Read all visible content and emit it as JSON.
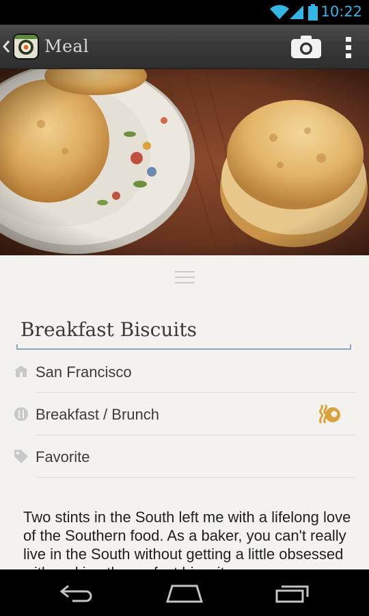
{
  "status_bar": {
    "time": "10:22",
    "icons": [
      "wifi-icon",
      "signal-icon",
      "battery-icon"
    ],
    "accent": "#33b5e5"
  },
  "action_bar": {
    "title": "Meal",
    "actions": [
      "camera-icon",
      "overflow-menu-icon"
    ]
  },
  "hero": {
    "description_icon": "biscuits-photo"
  },
  "meal": {
    "title": "Breakfast Biscuits",
    "location": "San Francisco",
    "category": "Breakfast / Brunch",
    "tag": "Favorite",
    "description": "Two stints in the South left me with a lifelong love of the Southern food. As a baker, you can't really live in the South without getting a little obsessed with making the perfect biscuit."
  },
  "colors": {
    "background": "#f3f2ee",
    "title_underline": "#8fa5b8",
    "category_icon": "#d9a23a",
    "action_bar": "#3a3a3a"
  },
  "nav_bar": {
    "buttons": [
      "back-icon",
      "home-icon",
      "recent-apps-icon"
    ]
  }
}
